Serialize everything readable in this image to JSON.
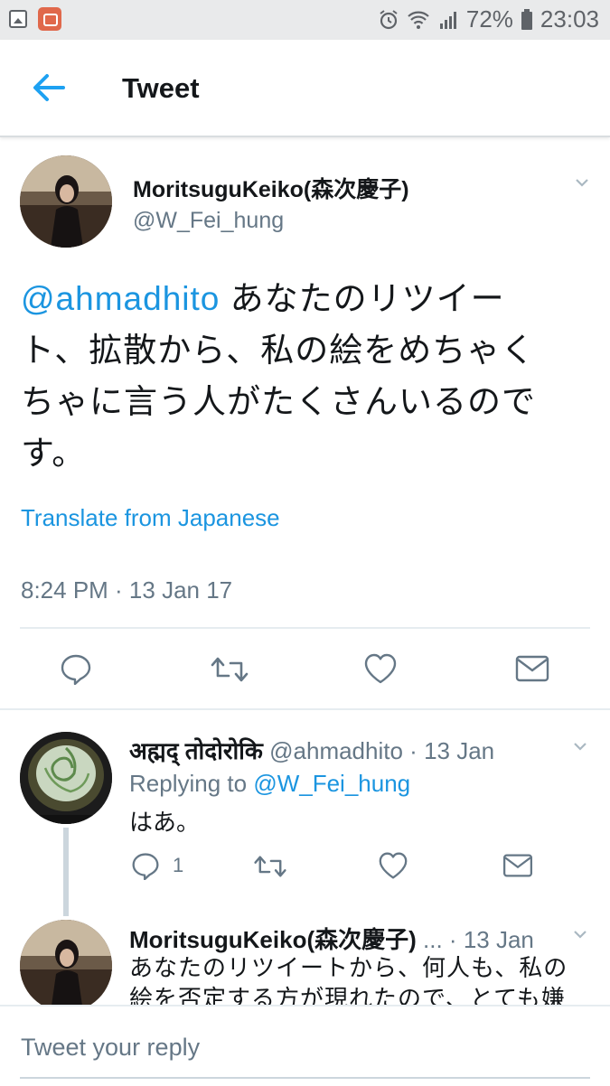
{
  "status_bar": {
    "battery": "72%",
    "time": "23:03"
  },
  "header": {
    "title": "Tweet"
  },
  "main_tweet": {
    "display_name": "MoritsuguKeiko(森次慶子)",
    "handle": "@W_Fei_hung",
    "mention": "@ahmadhito",
    "text_line1": " あなたのリツイー",
    "text_line2": "ト、拡散から、私の絵をめちゃく",
    "text_line3": "ちゃに言う人がたくさんいるので",
    "text_line4": "す。",
    "translate_link": "Translate from Japanese",
    "timestamp": "8:24 PM · 13 Jan 17"
  },
  "replies": [
    {
      "display_name": "अह्मद् तोदोरोकि",
      "handle": "@ahmadhito",
      "time": "13 Jan",
      "replying_prefix": "Replying to ",
      "replying_to": "@W_Fei_hung",
      "text": "はあ。",
      "reply_count": "1"
    },
    {
      "display_name": "MoritsuguKeiko(森次慶子)",
      "ellipsis": "...",
      "time": "13 Jan",
      "text_line1": "あなたのリツイートから、何人も、私の",
      "text_line2": "絵を否定する方が現れたので、とても嫌"
    }
  ],
  "reply_bar": {
    "placeholder": "Tweet your reply"
  },
  "icons": {
    "accent": "#1b95e0",
    "action_gray": "#657786"
  }
}
